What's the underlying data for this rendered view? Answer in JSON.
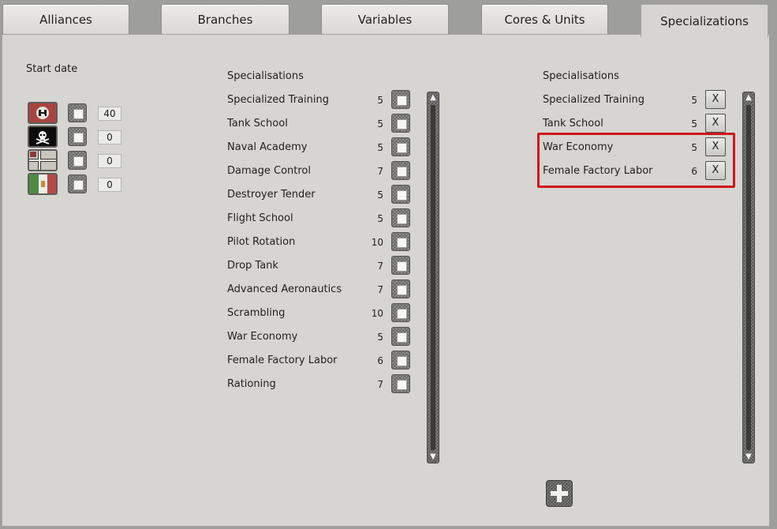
{
  "tabs": [
    {
      "label": "Alliances"
    },
    {
      "label": "Branches"
    },
    {
      "label": "Variables"
    },
    {
      "label": "Cores & Units"
    },
    {
      "label": "Specializations",
      "active": true
    }
  ],
  "start_date": {
    "label": "Start date",
    "rows": [
      {
        "flag": "germany-flag-icon",
        "value": "40"
      },
      {
        "flag": "skull-flag-icon",
        "value": "0"
      },
      {
        "flag": "cross-flag-icon",
        "value": "0"
      },
      {
        "flag": "italy-flag-icon",
        "value": "0"
      }
    ]
  },
  "available": {
    "header": "Specialisations",
    "items": [
      {
        "name": "Specialized Training",
        "cost": "5",
        "checked": false
      },
      {
        "name": "Tank School",
        "cost": "5",
        "checked": false
      },
      {
        "name": "Naval Academy",
        "cost": "5",
        "checked": false
      },
      {
        "name": "Damage Control",
        "cost": "7",
        "checked": false
      },
      {
        "name": "Destroyer Tender",
        "cost": "5",
        "checked": false
      },
      {
        "name": "Flight School",
        "cost": "5",
        "checked": false
      },
      {
        "name": "Pilot Rotation",
        "cost": "10",
        "checked": false
      },
      {
        "name": "Drop Tank",
        "cost": "7",
        "checked": false
      },
      {
        "name": "Advanced Aeronautics",
        "cost": "7",
        "checked": false
      },
      {
        "name": "Scrambling",
        "cost": "10",
        "checked": false
      },
      {
        "name": "War Economy",
        "cost": "5",
        "checked": false
      },
      {
        "name": "Female Factory Labor",
        "cost": "6",
        "checked": false
      },
      {
        "name": "Rationing",
        "cost": "7",
        "checked": false
      }
    ]
  },
  "selected": {
    "header": "Specialisations",
    "remove_label": "X",
    "items": [
      {
        "name": "Specialized Training",
        "cost": "5"
      },
      {
        "name": "Tank School",
        "cost": "5"
      },
      {
        "name": "War Economy",
        "cost": "5"
      },
      {
        "name": "Female Factory Labor",
        "cost": "6"
      }
    ]
  },
  "colors": {
    "highlight": "#d0151a",
    "panel": "#d6d5d2"
  },
  "add_button_icon": "plus-icon"
}
